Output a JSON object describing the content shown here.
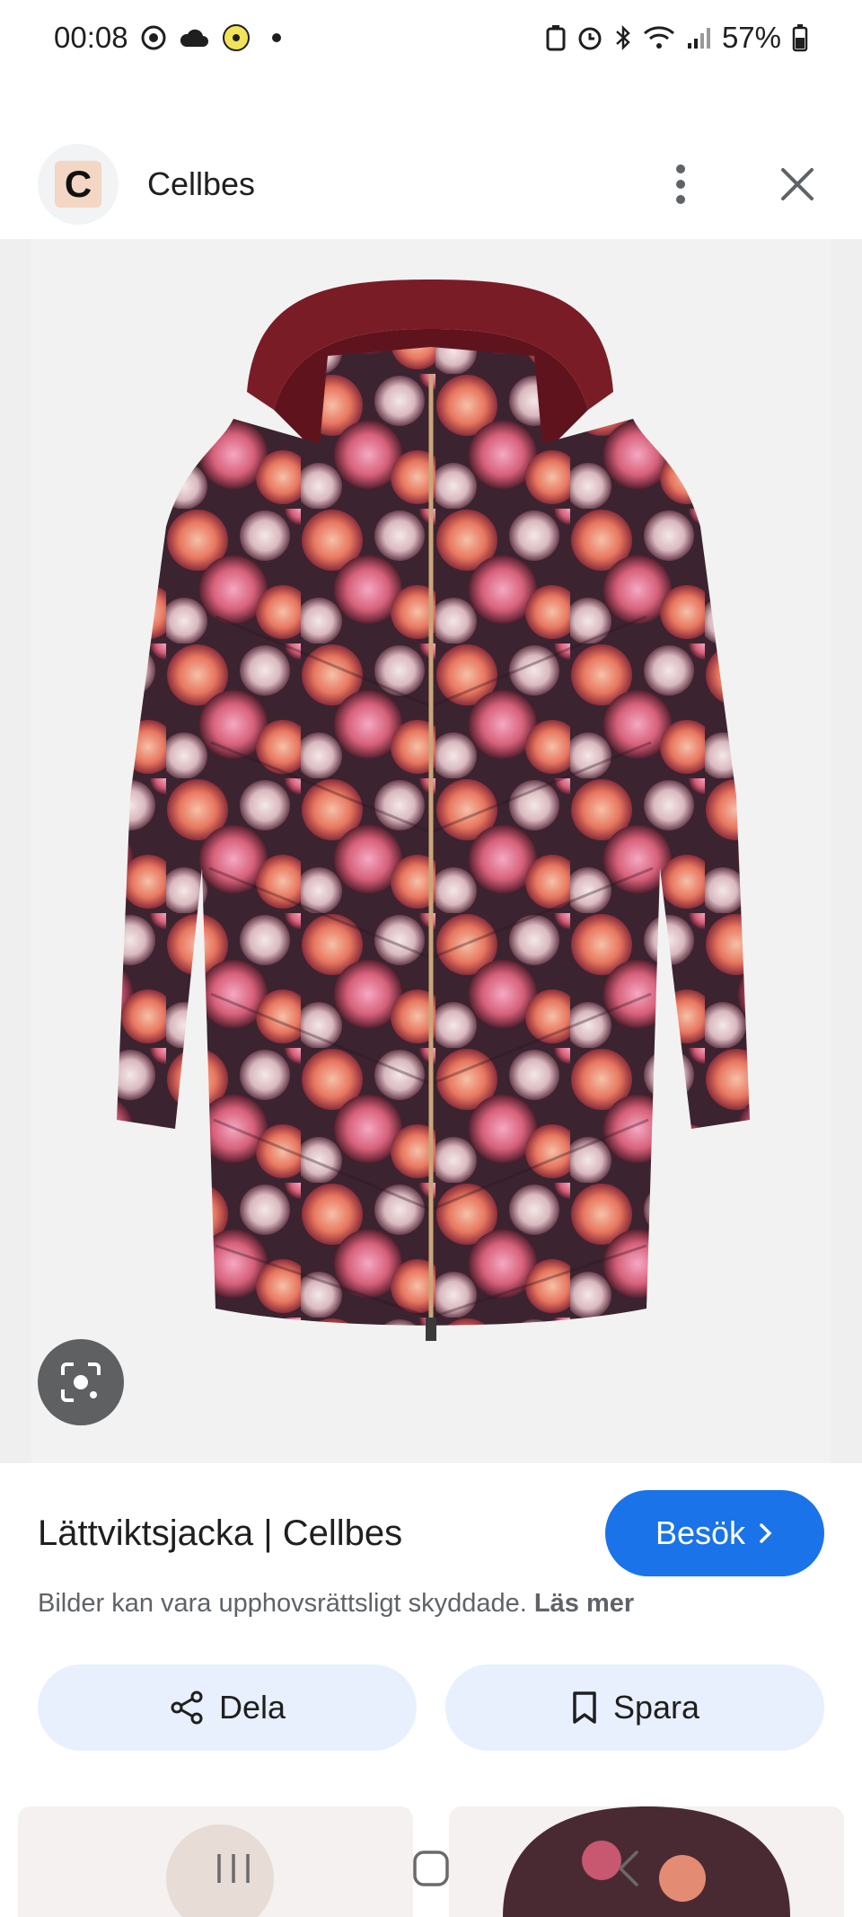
{
  "status_bar": {
    "time": "00:08",
    "battery": "57%"
  },
  "header": {
    "site_initial": "C",
    "site_name": "Cellbes"
  },
  "image": {
    "alt": "Floral lightweight padded jacket",
    "colors": {
      "background": "#efefef",
      "jacket_dark": "#3b2430",
      "jacket_pink": "#d7607a",
      "jacket_coral": "#e8765f",
      "jacket_cream": "#e8ddd6",
      "hood_lining": "#7a1c26"
    }
  },
  "info": {
    "title": "Lättviktsjacka | Cellbes",
    "visit_label": "Besök",
    "copyright_text": "Bilder kan vara upphovsrättsligt skyddade.",
    "read_more": "Läs mer",
    "share_label": "Dela",
    "save_label": "Spara"
  },
  "colors": {
    "accent": "#1a73e8",
    "pill_bg": "#e8f0fe"
  }
}
